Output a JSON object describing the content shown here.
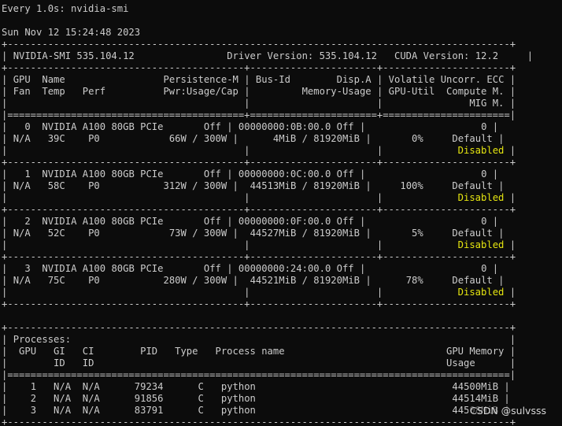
{
  "watch": {
    "command": "Every 1.0s: nvidia-smi",
    "timestamp": "Sun Nov 12 15:24:48 2023"
  },
  "header": {
    "smi": "NVIDIA-SMI 535.104.12",
    "driver": "Driver Version: 535.104.12",
    "cuda": "CUDA Version: 12.2"
  },
  "columns": {
    "c1_l1": "GPU  Name",
    "c1_l1r": "Persistence-M",
    "c1_l2": "Fan  Temp   Perf",
    "c1_l2r": "Pwr:Usage/Cap",
    "c2_l1": "Bus-Id        Disp.A",
    "c2_l2": "Memory-Usage",
    "c3_l1": "Volatile Uncorr. ECC",
    "c3_l2": "GPU-Util  Compute M.",
    "c3_l3": "MIG M."
  },
  "gpus": [
    {
      "idx": "0",
      "name": "NVIDIA A100 80GB PCIe",
      "persistence": "Off",
      "fan": "N/A",
      "temp": "39C",
      "perf": "P0",
      "power": "66W / 300W",
      "bus": "00000000:0B:00.0 Off",
      "memory": "4MiB / 81920MiB",
      "ecc": "0",
      "util": "0%",
      "compute": "Default",
      "mig": "Disabled"
    },
    {
      "idx": "1",
      "name": "NVIDIA A100 80GB PCIe",
      "persistence": "Off",
      "fan": "N/A",
      "temp": "58C",
      "perf": "P0",
      "power": "312W / 300W",
      "bus": "00000000:0C:00.0 Off",
      "memory": "44513MiB / 81920MiB",
      "ecc": "0",
      "util": "100%",
      "compute": "Default",
      "mig": "Disabled"
    },
    {
      "idx": "2",
      "name": "NVIDIA A100 80GB PCIe",
      "persistence": "Off",
      "fan": "N/A",
      "temp": "52C",
      "perf": "P0",
      "power": "73W / 300W",
      "bus": "00000000:0F:00.0 Off",
      "memory": "44527MiB / 81920MiB",
      "ecc": "0",
      "util": "5%",
      "compute": "Default",
      "mig": "Disabled"
    },
    {
      "idx": "3",
      "name": "NVIDIA A100 80GB PCIe",
      "persistence": "Off",
      "fan": "N/A",
      "temp": "75C",
      "perf": "P0",
      "power": "280W / 300W",
      "bus": "00000000:24:00.0 Off",
      "memory": "44521MiB / 81920MiB",
      "ecc": "0",
      "util": "78%",
      "compute": "Default",
      "mig": "Disabled"
    }
  ],
  "processes": {
    "title": "Processes:",
    "h1": "GPU   GI   CI        PID   Type   Process name",
    "h1r": "GPU Memory",
    "h2": "ID   ID",
    "h2r": "Usage",
    "rows": [
      {
        "gpu": "1",
        "gi": "N/A",
        "ci": "N/A",
        "pid": "79234",
        "type": "C",
        "name": "python",
        "mem": "44500MiB"
      },
      {
        "gpu": "2",
        "gi": "N/A",
        "ci": "N/A",
        "pid": "91856",
        "type": "C",
        "name": "python",
        "mem": "44514MiB"
      },
      {
        "gpu": "3",
        "gi": "N/A",
        "ci": "N/A",
        "pid": "83791",
        "type": "C",
        "name": "python",
        "mem": "44508MiB"
      }
    ]
  },
  "watermark": "CSDN @sulvsss",
  "colors": {
    "background": "#0c0c0c",
    "text": "#cccccc",
    "mig_warning": "#e5e510"
  }
}
